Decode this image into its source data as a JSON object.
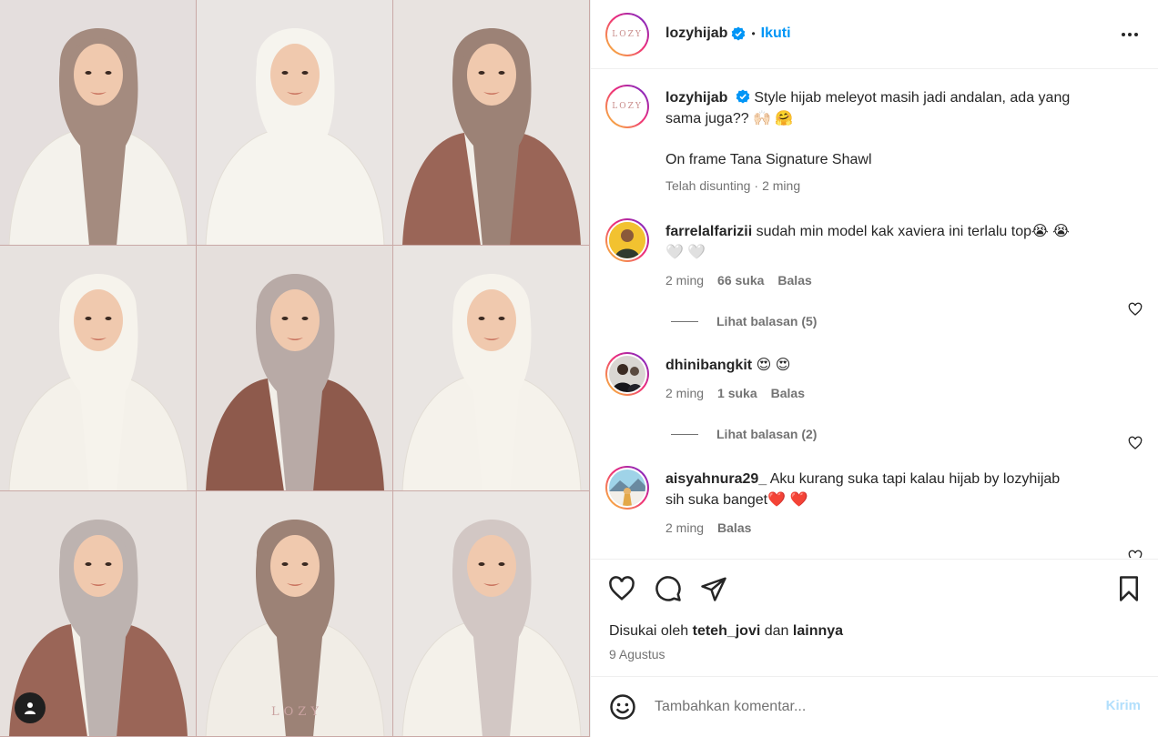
{
  "header": {
    "avatar_text": "LOZY",
    "username": "lozyhijab",
    "separator": "•",
    "follow_label": "Ikuti"
  },
  "media": {
    "watermark": "LOZY",
    "tiles": [
      {
        "bg": "#e4dedd",
        "hijab": "#a48b7f",
        "outfit": "#f4f2ec",
        "jacket": ""
      },
      {
        "bg": "#e9e5e3",
        "hijab": "#f6f4ee",
        "outfit": "#f6f4ee",
        "jacket": ""
      },
      {
        "bg": "#e8e3e0",
        "hijab": "#9c8276",
        "outfit": "#f2efe9",
        "jacket": "#9a6557"
      },
      {
        "bg": "#e7e2df",
        "hijab": "#f6f3ec",
        "outfit": "#f4f1ea",
        "jacket": ""
      },
      {
        "bg": "#e5dfdc",
        "hijab": "#b8aaa6",
        "outfit": "#f2efe9",
        "jacket": "#8e5a4c"
      },
      {
        "bg": "#e9e5e2",
        "hijab": "#f6f3ec",
        "outfit": "#f5f2eb",
        "jacket": ""
      },
      {
        "bg": "#e6e0dd",
        "hijab": "#bdb3b0",
        "outfit": "#f4f1ea",
        "jacket": "#9a6557"
      },
      {
        "bg": "#e9e4e1",
        "hijab": "#9c8276",
        "outfit": "#f1ede6",
        "jacket": ""
      },
      {
        "bg": "#eae6e3",
        "hijab": "#d2c7c4",
        "outfit": "#f4f1ea",
        "jacket": ""
      }
    ]
  },
  "caption": {
    "username": "lozyhijab",
    "text_line1": "Style hijab meleyot masih jadi andalan, ada yang",
    "text_line2": "sama juga?? 🙌🏻 🤗",
    "text_line3": "On frame Tana Signature Shawl",
    "edited": "Telah disunting",
    "dot": "·",
    "time": "2 ming"
  },
  "comments": [
    {
      "username": "farrelalfarizii",
      "text": "sudah min model kak xaviera ini terlalu top😭 😭",
      "text_cont": "🤍 🤍",
      "time": "2 ming",
      "likes": "66 suka",
      "reply": "Balas",
      "view_replies": "Lihat balasan (5)"
    },
    {
      "username": "dhinibangkit",
      "text": "😍 😍",
      "time": "2 ming",
      "likes": "1 suka",
      "reply": "Balas",
      "view_replies": "Lihat balasan (2)"
    },
    {
      "username": "aisyahnura29_",
      "text": "Aku kurang suka tapi kalau hijab by lozyhijab",
      "text_cont": "sih suka banget❤️ ❤️",
      "time": "2 ming",
      "reply": "Balas"
    }
  ],
  "actions": {
    "liked_prefix": "Disukai oleh",
    "liked_user": "teteh_jovi",
    "liked_and": "dan",
    "liked_others": "lainnya",
    "date": "9 Agustus"
  },
  "composer": {
    "placeholder": "Tambahkan komentar...",
    "send_label": "Kirim"
  },
  "colors": {
    "accent": "#0095f6",
    "send_disabled": "#b2dffc",
    "heart_red": "#ed4956"
  }
}
